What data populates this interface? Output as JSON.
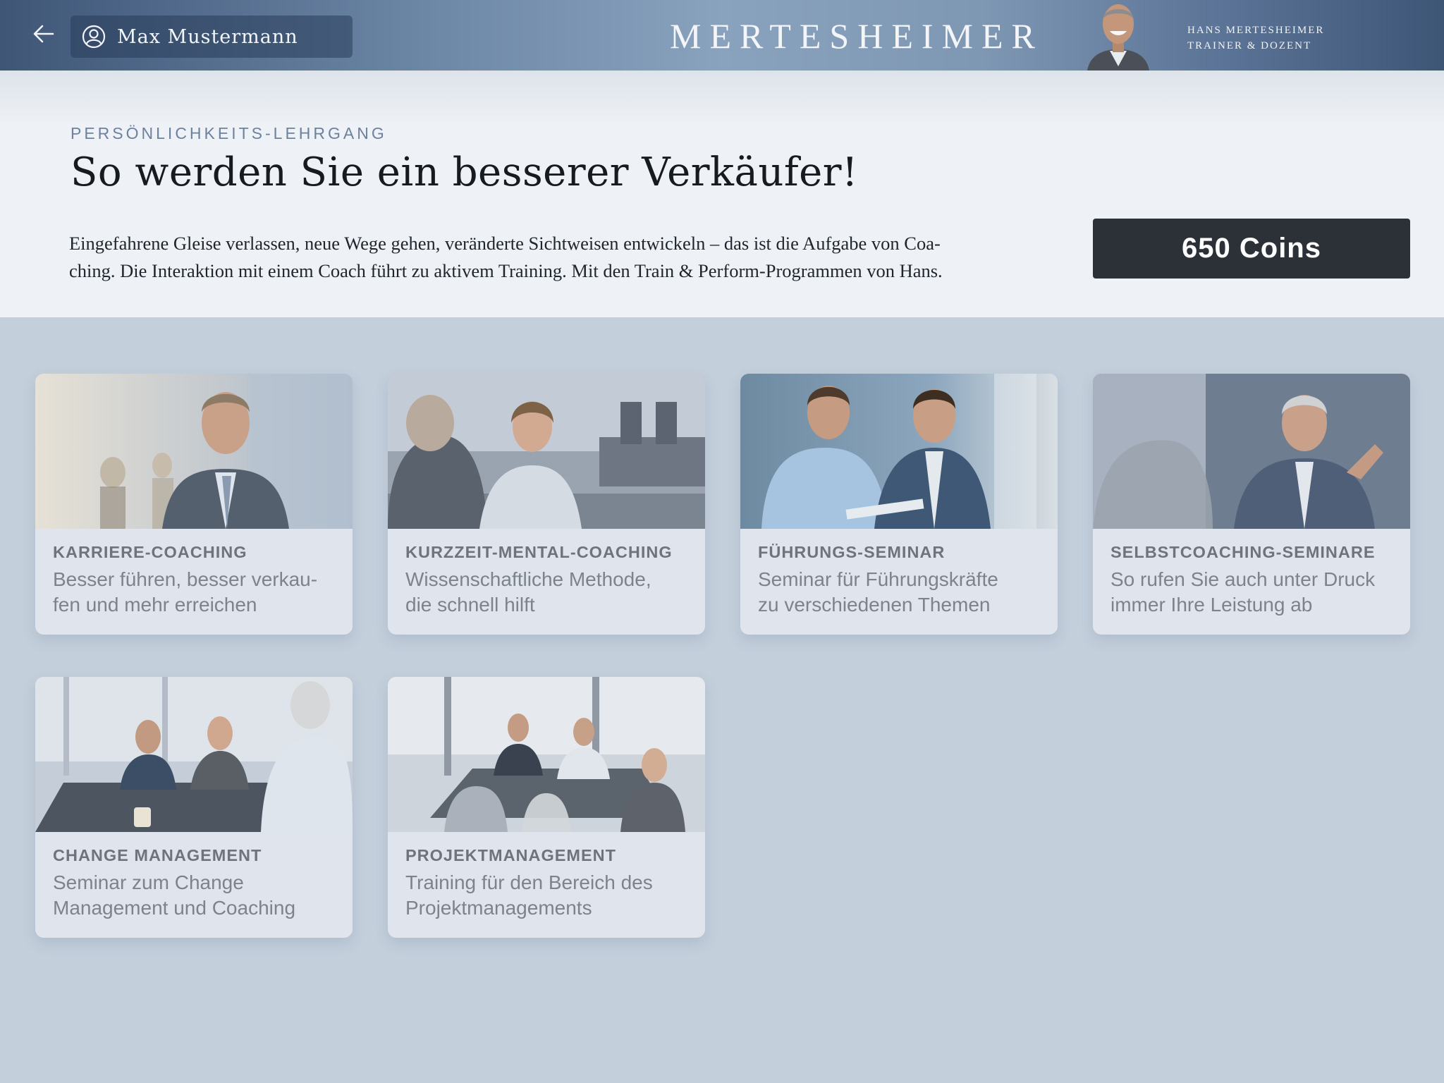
{
  "header": {
    "user_name": "Max Mustermann",
    "brand": "MERTESHEIMER",
    "trainer_name": "HANS MERTESHEIMER",
    "trainer_role": "TRAINER & DOZENT"
  },
  "hero": {
    "eyebrow": "PERSÖNLICHKEITS-LEHRGANG",
    "title": "So werden Sie ein besserer Verkäufer!",
    "description_line1": "Eingefahrene Gleise verlassen, neue Wege gehen, veränderte Sichtweisen entwickeln – das ist die Aufgabe von Coa-",
    "description_line2": "ching. Die Interaktion mit einem Coach führt zu aktivem Training. Mit den Train & Perform-Programmen von Hans.",
    "coins_label": "650 Coins"
  },
  "cards": [
    {
      "title": "KARRIERE-COACHING",
      "desc_line1": "Besser führen, besser verkau-",
      "desc_line2": "fen und mehr erreichen"
    },
    {
      "title": "KURZZEIT-MENTAL-COACHING",
      "desc_line1": "Wissenschaftliche Methode,",
      "desc_line2": "die schnell hilft"
    },
    {
      "title": "FÜHRUNGS-SEMINAR",
      "desc_line1": "Seminar für Führungskräfte",
      "desc_line2": "zu verschiedenen Themen"
    },
    {
      "title": "SELBSTCOACHING-SEMINARE",
      "desc_line1": "So rufen Sie auch unter Druck",
      "desc_line2": "immer Ihre Leistung ab"
    },
    {
      "title": "CHANGE MANAGEMENT",
      "desc_line1": "Seminar zum Change",
      "desc_line2": "Management und Coaching"
    },
    {
      "title": "PROJEKTMANAGEMENT",
      "desc_line1": "Training für den Bereich des",
      "desc_line2": "Projektmanagements"
    }
  ],
  "icons": {
    "back": "arrow-left-icon",
    "user": "user-circle-icon"
  },
  "colors": {
    "coins_button": "#2c3138",
    "eyebrow": "#6c829e",
    "page_background": "#c3cfdb"
  }
}
